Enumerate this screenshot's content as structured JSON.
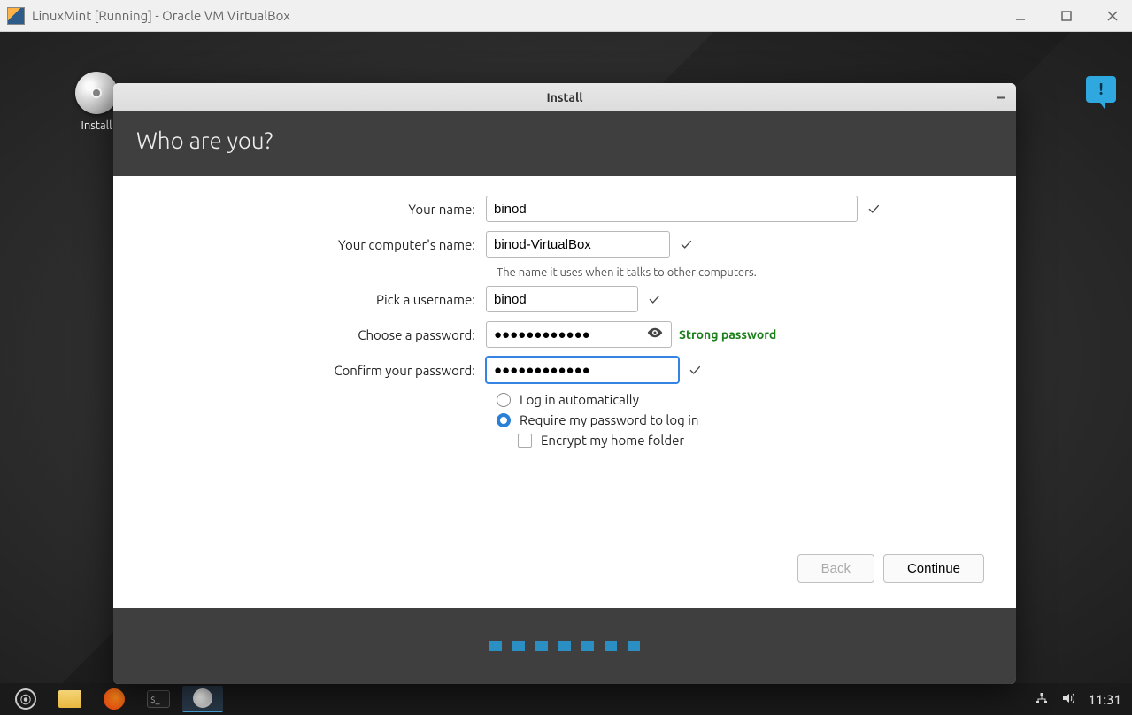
{
  "vbox": {
    "title": "LinuxMint [Running] - Oracle VM VirtualBox"
  },
  "desktop": {
    "install_icon_label": "Install"
  },
  "installer": {
    "window_title": "Install",
    "heading": "Who are you?",
    "fields": {
      "name_label": "Your name:",
      "name_value": "binod",
      "computer_label": "Your computer's name:",
      "computer_value": "binod-VirtualBox",
      "computer_hint": "The name it uses when it talks to other computers.",
      "username_label": "Pick a username:",
      "username_value": "binod",
      "password_label": "Choose a password:",
      "password_value": "●●●●●●●●●●●●",
      "password_strength": "Strong password",
      "confirm_label": "Confirm your password:",
      "confirm_value": "●●●●●●●●●●●●"
    },
    "options": {
      "auto_login": "Log in automatically",
      "require_password": "Require my password to log in",
      "encrypt_home": "Encrypt my home folder",
      "selected": "require_password"
    },
    "buttons": {
      "back": "Back",
      "continue": "Continue"
    }
  },
  "taskbar": {
    "clock": "11:31"
  }
}
